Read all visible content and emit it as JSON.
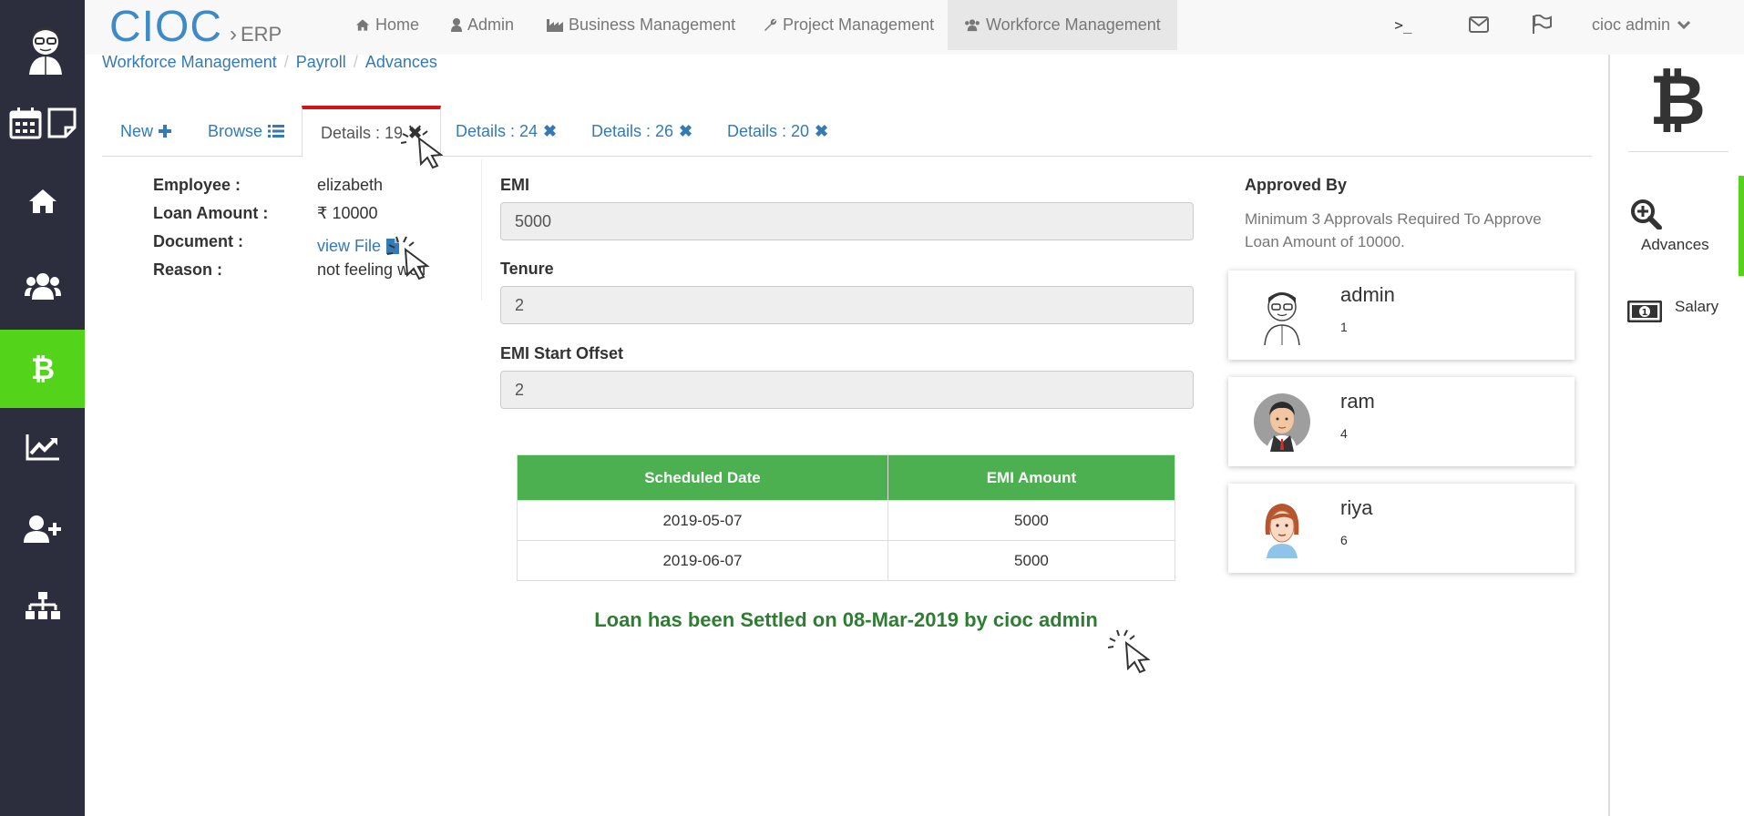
{
  "brand": {
    "name": "CIOC",
    "separator": "›",
    "product": "ERP"
  },
  "topnav": {
    "items": [
      {
        "label": "Home",
        "icon": "home-icon"
      },
      {
        "label": "Admin",
        "icon": "user-icon"
      },
      {
        "label": "Business Management",
        "icon": "industry-icon"
      },
      {
        "label": "Project Management",
        "icon": "wrench-icon"
      },
      {
        "label": "Workforce Management",
        "icon": "users-icon"
      }
    ],
    "terminal_label": ">_",
    "user_label": "cioc admin"
  },
  "breadcrumb": [
    "Workforce Management",
    "Payroll",
    "Advances"
  ],
  "tabs": [
    {
      "label": "New"
    },
    {
      "label": "Browse"
    },
    {
      "label": "Details : 19"
    },
    {
      "label": "Details : 24"
    },
    {
      "label": "Details : 26"
    },
    {
      "label": "Details : 20"
    }
  ],
  "details": {
    "employee_label": "Employee :",
    "employee": "elizabeth",
    "loan_label": "Loan Amount :",
    "loan": "₹ 10000",
    "document_label": "Document :",
    "document": "view File",
    "reason_label": "Reason :",
    "reason": "not feeling well"
  },
  "form": {
    "emi_label": "EMI",
    "emi": "5000",
    "tenure_label": "Tenure",
    "tenure": "2",
    "offset_label": "EMI Start Offset",
    "offset": "2"
  },
  "schedule": {
    "headers": [
      "Scheduled Date",
      "EMI Amount"
    ],
    "rows": [
      [
        "2019-05-07",
        "5000"
      ],
      [
        "2019-06-07",
        "5000"
      ]
    ]
  },
  "settled_message": "Loan has been Settled on 08-Mar-2019 by cioc admin",
  "approvals": {
    "title": "Approved By",
    "note": "Minimum 3 Approvals Required To Approve Loan Amount of 10000.",
    "approvers": [
      {
        "name": "admin",
        "number": "1"
      },
      {
        "name": "ram",
        "number": "4"
      },
      {
        "name": "riya",
        "number": "6"
      }
    ]
  },
  "rightpanel": {
    "items": [
      {
        "label": "Advances",
        "icon": "search-plus-icon"
      },
      {
        "label": "Salary",
        "icon": "money-icon"
      }
    ]
  },
  "colors": {
    "sidebar": "#2c2e3e",
    "sidebar_active": "#53d41a",
    "table_header": "#4caf50",
    "settled_text": "#2e7d32",
    "active_tab_border": "#d0141a",
    "link": "#337ab7"
  }
}
